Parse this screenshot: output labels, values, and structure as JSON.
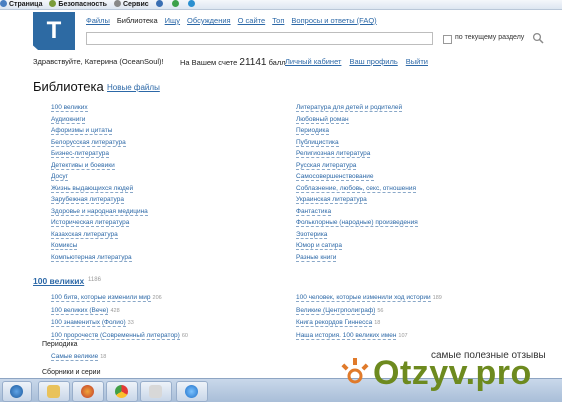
{
  "ie_bar": {
    "items": [
      "Страница",
      "Безопасность",
      "Сервис"
    ]
  },
  "logo": {
    "letter": "T"
  },
  "topnav": {
    "items": [
      "Файлы",
      "Библиотека",
      "Ищу",
      "Обсуждения",
      "О сайте",
      "Топ",
      "Вопросы и ответы (FAQ)"
    ],
    "current_index": 1
  },
  "search": {
    "value": "",
    "scope_label": "по текущему разделу"
  },
  "greeting": "Здравствуйте, Катерина (OceanSoul)!",
  "account": {
    "label": "На Вашем счете",
    "balance": "21141",
    "unit": "балл"
  },
  "user_links": [
    "Личный кабинет",
    "Ваш профиль",
    "Выйти"
  ],
  "library": {
    "title": "Библиотека",
    "new_files": "Новые файлы",
    "left_categories": [
      "100 великих",
      "Аудиокниги",
      "Афоризмы и цитаты",
      "Белорусская литература",
      "Бизнес-литература",
      "Детективы и боевики",
      "Досуг",
      "Жизнь выдающихся людей",
      "Зарубежная литература",
      "Здоровье и народная медицина",
      "Историческая литература",
      "Казахская литература",
      "Комиксы",
      "Компьютерная литература"
    ],
    "right_categories": [
      "Литература для детей и родителей",
      "Любовный роман",
      "Периодика",
      "Публицистика",
      "Религиозная литература",
      "Русская литература",
      "Самосовершенствование",
      "Соблазнение, любовь, секс, отношения",
      "Украинская литература",
      "Фантастика",
      "Фольклорные (народные) произведения",
      "Эзотерика",
      "Юмор и сатира",
      "Разные книги"
    ]
  },
  "section_100": {
    "title": "100 великих",
    "count": "1186",
    "left": [
      {
        "title": "100 битв, которые изменили мир",
        "count": "206"
      },
      {
        "title": "100 великих (Вече)",
        "count": "428"
      },
      {
        "title": "100 знаменитых (Фолио)",
        "count": "33"
      },
      {
        "title": "100 пророчеств (Современный литератор)",
        "count": "60"
      }
    ],
    "right": [
      {
        "title": "100 человек, которые изменили ход истории",
        "count": "189"
      },
      {
        "title": "Великие (Центрполиграф)",
        "count": "56"
      },
      {
        "title": "Книга рекордов Гиннесса",
        "count": "18"
      },
      {
        "title": "Наша история. 100 великих имен",
        "count": "107"
      }
    ]
  },
  "periodika": {
    "title": "Периодика",
    "item": {
      "title": "Самые великие",
      "count": "18"
    }
  },
  "collections_title": "Сборники и серии",
  "watermark": {
    "tagline": "самые полезные отзывы",
    "text": "Otzyv.pro"
  },
  "colors": {
    "link": "#2c68a7",
    "logo_bg": "#2d6aa3",
    "watermark": "#6d8a1f"
  }
}
